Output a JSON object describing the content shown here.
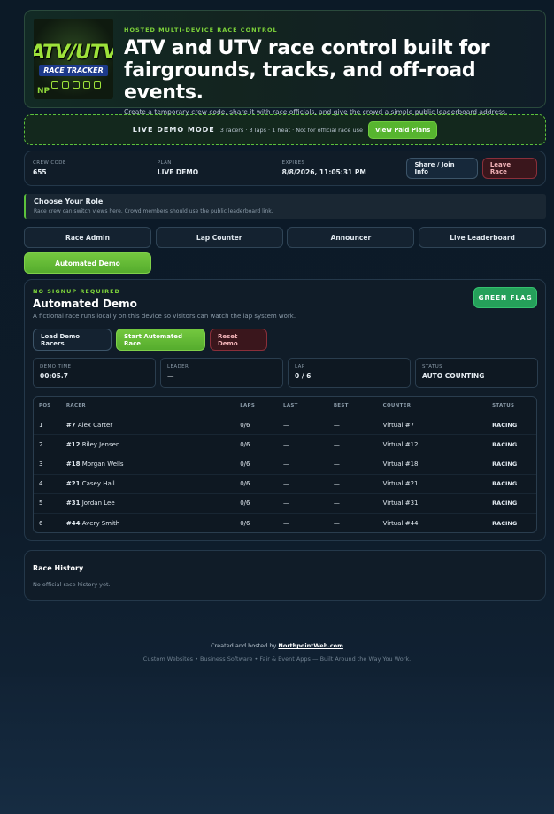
{
  "hero": {
    "logo": {
      "line1": "ATV/UTV",
      "line2": "RACE TRACKER",
      "badge": "NP"
    },
    "eyebrow": "HOSTED MULTI-DEVICE RACE CONTROL",
    "title": "ATV and UTV race control built for fairgrounds, tracks, and off-road events.",
    "subtitle": "Create a temporary crew code, share it with race officials, and give the crowd a simple public leaderboard address."
  },
  "demo_banner": {
    "title": "LIVE DEMO MODE",
    "info": "3 racers · 3 laps · 1 heat · Not for official race use",
    "button": "View Paid Plans"
  },
  "crew": {
    "code_label": "CREW CODE",
    "code": "655",
    "plan_label": "PLAN",
    "plan": "LIVE DEMO",
    "expires_label": "EXPIRES",
    "expires": "8/8/2026, 11:05:31 PM",
    "share_button": "Share / Join Info",
    "leave_button": "Leave Race"
  },
  "role_section": {
    "title": "Choose Your Role",
    "subtitle": "Race crew can switch views here. Crowd members should use the public leaderboard link."
  },
  "roles": [
    "Race Admin",
    "Lap Counter",
    "Announcer",
    "Live Leaderboard",
    "Automated Demo"
  ],
  "demo": {
    "eyebrow": "NO SIGNUP REQUIRED",
    "title": "Automated Demo",
    "subtitle": "A fictional race runs locally on this device so visitors can watch the lap system work.",
    "flag": "GREEN FLAG",
    "load_button": "Load Demo Racers",
    "start_button": "Start Automated Race",
    "reset_button": "Reset Demo",
    "stats": [
      {
        "label": "DEMO TIME",
        "value": "00:05.7"
      },
      {
        "label": "LEADER",
        "value": "—"
      },
      {
        "label": "LAP",
        "value": "0 / 6"
      },
      {
        "label": "STATUS",
        "value": "AUTO COUNTING"
      }
    ],
    "columns": [
      "POS",
      "RACER",
      "LAPS",
      "LAST",
      "BEST",
      "COUNTER",
      "STATUS"
    ],
    "rows": [
      {
        "pos": "1",
        "num": "#7",
        "name": "Alex Carter",
        "laps": "0/6",
        "last": "—",
        "best": "—",
        "counter": "Virtual #7",
        "status": "RACING"
      },
      {
        "pos": "2",
        "num": "#12",
        "name": "Riley Jensen",
        "laps": "0/6",
        "last": "—",
        "best": "—",
        "counter": "Virtual #12",
        "status": "RACING"
      },
      {
        "pos": "3",
        "num": "#18",
        "name": "Morgan Wells",
        "laps": "0/6",
        "last": "—",
        "best": "—",
        "counter": "Virtual #18",
        "status": "RACING"
      },
      {
        "pos": "4",
        "num": "#21",
        "name": "Casey Hall",
        "laps": "0/6",
        "last": "—",
        "best": "—",
        "counter": "Virtual #21",
        "status": "RACING"
      },
      {
        "pos": "5",
        "num": "#31",
        "name": "Jordan Lee",
        "laps": "0/6",
        "last": "—",
        "best": "—",
        "counter": "Virtual #31",
        "status": "RACING"
      },
      {
        "pos": "6",
        "num": "#44",
        "name": "Avery Smith",
        "laps": "0/6",
        "last": "—",
        "best": "—",
        "counter": "Virtual #44",
        "status": "RACING"
      }
    ]
  },
  "history": {
    "title": "Race History",
    "empty": "No official race history yet."
  },
  "footer": {
    "prefix": "Created and hosted by",
    "link": "NorthpointWeb.com",
    "tagline": "Custom Websites • Business Software • Fair & Event Apps — Built Around the Way You Work."
  },
  "colors": {
    "accent": "#5cc23c",
    "flag": "#25a05a",
    "danger": "#8a2f3a",
    "background": "#0c1a27"
  }
}
